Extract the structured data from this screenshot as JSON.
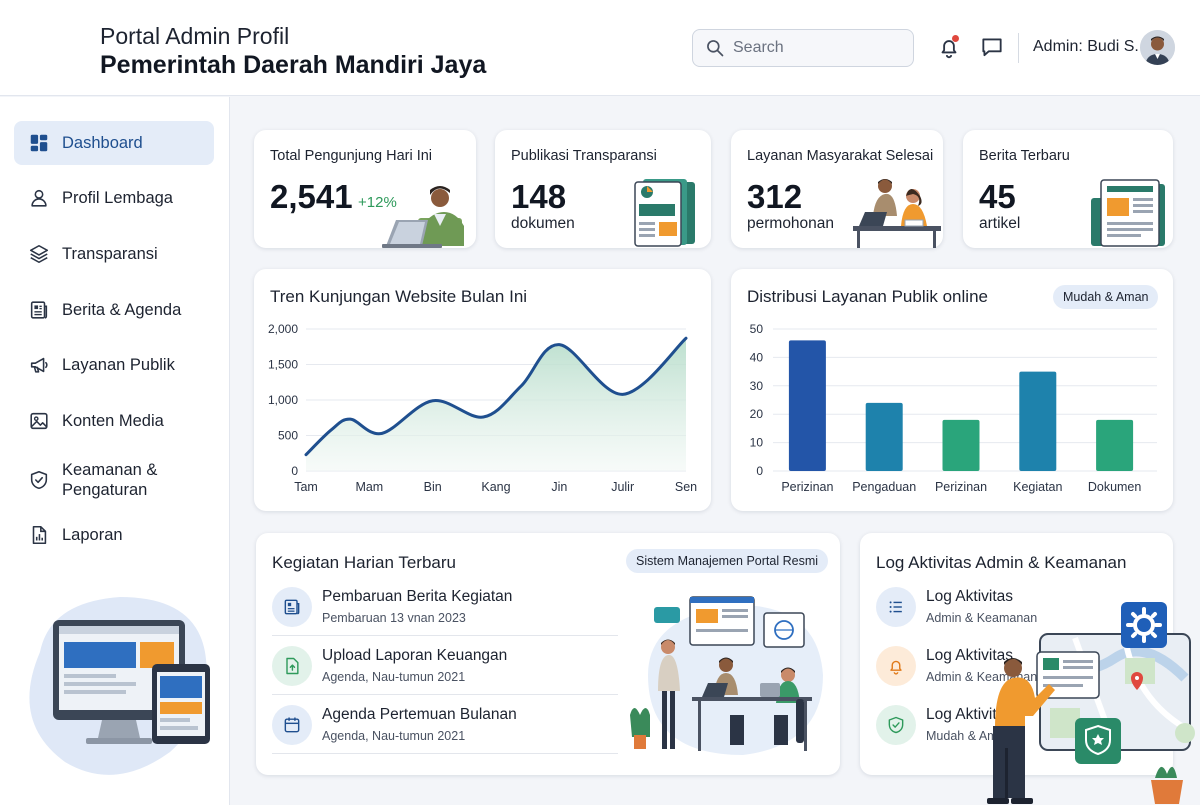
{
  "header": {
    "subtitle": "Portal Admin Profil",
    "title": "Pemerintah Daerah Mandiri Jaya",
    "search_placeholder": "Search",
    "admin_label": "Admin: Budi S."
  },
  "sidebar": {
    "items": [
      {
        "label": "Dashboard",
        "icon": "dashboard-icon",
        "active": true
      },
      {
        "label": "Profil Lembaga",
        "icon": "user-icon"
      },
      {
        "label": "Transparansi",
        "icon": "layers-icon"
      },
      {
        "label": "Berita & Agenda",
        "icon": "newspaper-icon"
      },
      {
        "label": "Layanan Publik",
        "icon": "megaphone-icon"
      },
      {
        "label": "Konten Media",
        "icon": "image-icon"
      },
      {
        "label": "Keamanan & Pengaturan",
        "line1": "Keamanan &",
        "line2": "Pengaturan",
        "icon": "shield-icon"
      },
      {
        "label": "Laporan",
        "icon": "report-icon"
      }
    ]
  },
  "stats": [
    {
      "title": "Total Pengunjung Hari Ini",
      "value": "2,541",
      "change": "+12%"
    },
    {
      "title": "Publikasi Transparansi",
      "value": "148",
      "unit": "dokumen"
    },
    {
      "title": "Layanan Masyarakat Selesai",
      "value": "312",
      "unit": "permohonan"
    },
    {
      "title": "Berita Terbaru",
      "value": "45",
      "unit": "artikel"
    }
  ],
  "trend_panel": {
    "title": "Tren Kunjungan Website Bulan Ini"
  },
  "dist_panel": {
    "title": "Distribusi Layanan Publik online",
    "badge": "Mudah & Aman"
  },
  "chart_data": [
    {
      "type": "area",
      "title": "Tren Kunjungan Website Bulan Ini",
      "categories": [
        "Tam",
        "Mam",
        "Bin",
        "Kang",
        "Jin",
        "Julir",
        "Sen"
      ],
      "x_positions": [
        0,
        1,
        2,
        3,
        4,
        5,
        6
      ],
      "points": [
        [
          0,
          230
        ],
        [
          0.4,
          580
        ],
        [
          0.7,
          730
        ],
        [
          1.2,
          530
        ],
        [
          2.0,
          990
        ],
        [
          2.8,
          760
        ],
        [
          3.4,
          1200
        ],
        [
          4.0,
          1780
        ],
        [
          5.0,
          1080
        ],
        [
          6.0,
          1870
        ]
      ],
      "ylim": [
        0,
        2000
      ],
      "yticks": [
        0,
        500,
        1000,
        1500,
        2000
      ],
      "ytick_labels": [
        "0",
        "500",
        "1,000",
        "1,500",
        "2,000"
      ],
      "grid": true,
      "colors": {
        "line": "#1f4f8f",
        "fill_top": "#b5dcc9",
        "fill_bottom": "#f2f8f5"
      }
    },
    {
      "type": "bar",
      "title": "Distribusi Layanan Publik online",
      "categories": [
        "Perizinan",
        "Pengaduan",
        "Perizinan",
        "Kegiatan",
        "Dokumen"
      ],
      "values": [
        46,
        24,
        18,
        35,
        18
      ],
      "ylim": [
        0,
        50
      ],
      "yticks": [
        0,
        10,
        20,
        30,
        40,
        50
      ],
      "grid": true,
      "colors": [
        "#2355a8",
        "#1e82ac",
        "#2aa57b",
        "#1e82ac",
        "#2aa57b"
      ]
    }
  ],
  "activities": {
    "title": "Kegiatan Harian Terbaru",
    "badge": "Sistem Manajemen Portal Resmi",
    "items": [
      {
        "title": "Pembaruan Berita Kegiatan",
        "sub": "Pembaruan 13 vnan 2023",
        "icon": "newspaper-icon"
      },
      {
        "title": "Upload Laporan Keuangan",
        "sub": "Agenda, Nau-tumun 2021",
        "icon": "upload-icon"
      },
      {
        "title": "Agenda Pertemuan Bulanan",
        "sub": "Agenda, Nau-tumun 2021",
        "icon": "calendar-icon"
      }
    ]
  },
  "logs": {
    "title": "Log Aktivitas Admin & Keamanan",
    "items": [
      {
        "title": "Log Aktivitas",
        "sub": "Admin & Keamanan",
        "icon": "list-icon"
      },
      {
        "title": "Log Aktivitas",
        "sub": "Admin & Keamanan",
        "icon": "bell-icon"
      },
      {
        "title": "Log Aktivitas",
        "sub": "Mudah & Aman",
        "icon": "shield-check-icon"
      }
    ]
  },
  "colors": {
    "primary": "#1f4f8f",
    "accent_green": "#2e9a5b",
    "active_bg": "#e4ecf8"
  }
}
